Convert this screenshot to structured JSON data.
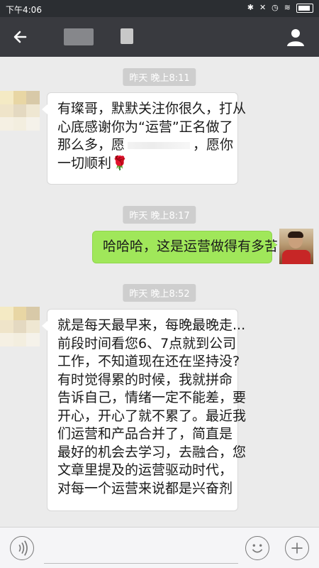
{
  "status_bar": {
    "time": "下午4:06",
    "icons": [
      "bluetooth-icon",
      "mute-icon",
      "alarm-icon",
      "wifi-icon",
      "battery-icon"
    ]
  },
  "header": {
    "back_icon": "arrow-left-icon",
    "profile_icon": "person-icon"
  },
  "messages": [
    {
      "timestamp": "昨天 晚上8:11",
      "direction": "incoming",
      "lines": [
        "有璨哥，默默关注你很久，打从",
        "心底感谢你为“运营”正名做了",
        "那么多，愿",
        "，愿你",
        "一切顺利"
      ],
      "emoji": "🌹"
    },
    {
      "timestamp": "昨天 晚上8:17",
      "direction": "outgoing",
      "lines": [
        "哈哈哈，这是运营做得有多苦"
      ]
    },
    {
      "timestamp": "昨天 晚上8:52",
      "direction": "incoming",
      "lines": [
        "就是每天最早来，每晚最晚走...",
        "前段时间看您6、7点就到公司",
        "工作，不知道现在还在坚持没?",
        "有时觉得累的时候，我就拼命",
        "告诉自己，情绪一定不能差，要",
        "开心，开心了就不累了。最近我",
        "们运营和产品合并了，简直是",
        "最好的机会去学习，去融合，您",
        "文章里提及的运营驱动时代，",
        "对每一个运营来说都是兴奋剂"
      ]
    }
  ],
  "input_bar": {
    "voice_icon": "voice-icon",
    "emoji_icon": "emoji-icon",
    "plus_icon": "plus-icon",
    "placeholder": ""
  },
  "colors": {
    "header": "#393a3f",
    "background": "#ebebeb",
    "incoming_bubble": "#ffffff",
    "outgoing_bubble": "#a0e75a"
  }
}
